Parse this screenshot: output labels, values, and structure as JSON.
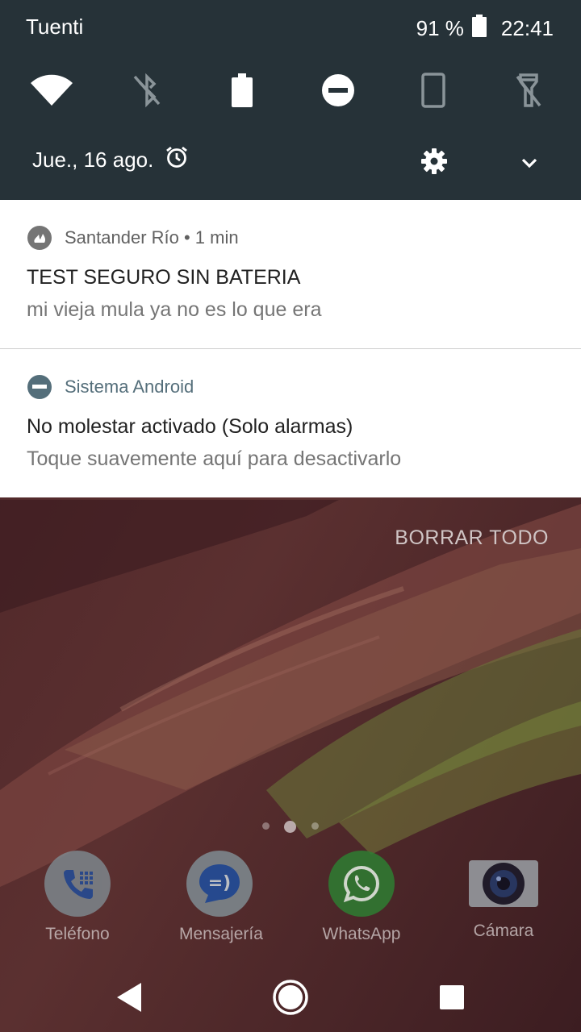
{
  "status_bar": {
    "carrier": "Tuenti",
    "battery": "91 %",
    "time": "22:41"
  },
  "quick_settings": {
    "tiles": [
      "wifi-icon",
      "bluetooth-off-icon",
      "battery-saver-icon",
      "do-not-disturb-icon",
      "screen-rotation-icon",
      "flashlight-off-icon"
    ],
    "date": "Jue., 16 ago."
  },
  "notifications": [
    {
      "app": "Santander Río",
      "age": " • 1 min",
      "title": "TEST SEGURO SIN BATERIA",
      "text": "mi vieja mula ya no es lo que era",
      "icon": "santander-icon"
    },
    {
      "app": "Sistema Android",
      "title": "No molestar activado (Solo alarmas)",
      "text": "Toque suavemente aquí para desactivarlo",
      "icon": "do-not-disturb-icon"
    }
  ],
  "clear_all": "BORRAR TODO",
  "dock": [
    {
      "label": "Teléfono",
      "icon": "phone-icon"
    },
    {
      "label": "Mensajería",
      "icon": "messaging-icon"
    },
    {
      "label": "WhatsApp",
      "icon": "whatsapp-icon"
    },
    {
      "label": "Cámara",
      "icon": "camera-icon"
    }
  ],
  "page_indicator": {
    "pages": 3,
    "current": 2
  },
  "colors": {
    "shade": "#263238",
    "notification_bg": "#ffffff",
    "whatsapp_green": "#2e7d32",
    "messaging_blue": "#1e4fa0"
  }
}
